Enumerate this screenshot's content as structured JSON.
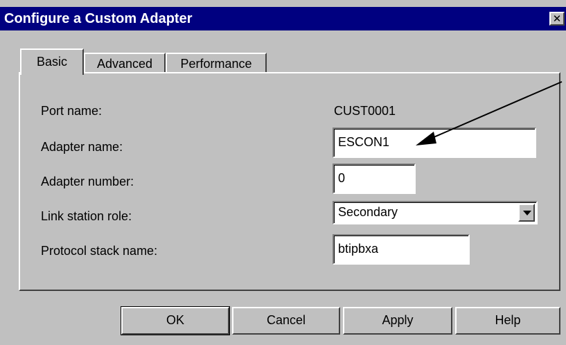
{
  "window": {
    "title": "Configure a Custom Adapter",
    "close_symbol": "✕"
  },
  "tabs": [
    {
      "label": "Basic",
      "active": true
    },
    {
      "label": "Advanced",
      "active": false
    },
    {
      "label": "Performance",
      "active": false
    }
  ],
  "form": {
    "port_name_label": "Port name:",
    "port_name_value": "CUST0001",
    "adapter_name_label": "Adapter name:",
    "adapter_name_value": "ESCON1",
    "adapter_number_label": "Adapter number:",
    "adapter_number_value": "0",
    "link_station_role_label": "Link station role:",
    "link_station_role_value": "Secondary",
    "protocol_stack_label": "Protocol stack name:",
    "protocol_stack_value": "btipbxa"
  },
  "buttons": {
    "ok": "OK",
    "cancel": "Cancel",
    "apply": "Apply",
    "help": "Help"
  },
  "icons": {
    "close": "close-icon",
    "dropdown": "chevron-down-icon",
    "annotation": "arrow-icon"
  },
  "colors": {
    "titlebar": "#000080",
    "face": "#c0c0c0"
  }
}
